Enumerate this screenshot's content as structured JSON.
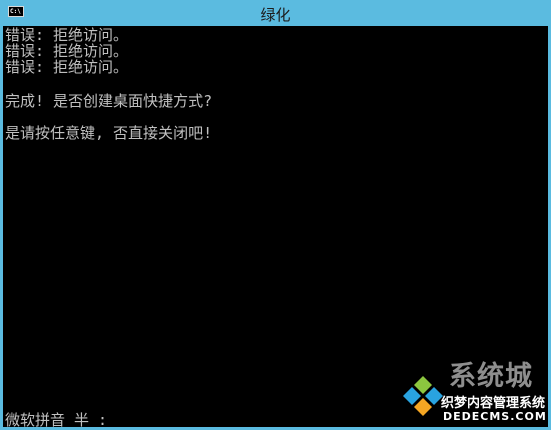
{
  "window": {
    "title": "绿化",
    "icon_label": "C:\\",
    "titlebar_color": "#5bbbe0"
  },
  "console": {
    "lines": [
      "错误: 拒绝访问。",
      "错误: 拒绝访问。",
      "错误: 拒绝访问。",
      "",
      "完成! 是否创建桌面快捷方式?",
      "",
      "是请按任意键, 否直接关闭吧!"
    ],
    "text_color": "#c0c0c0",
    "background": "#000000"
  },
  "ime": {
    "text": "微软拼音 半 :"
  },
  "watermark": {
    "brand": "系统城",
    "slogan": "织梦内容管理系统",
    "domain": "DEDECMS.COM"
  }
}
